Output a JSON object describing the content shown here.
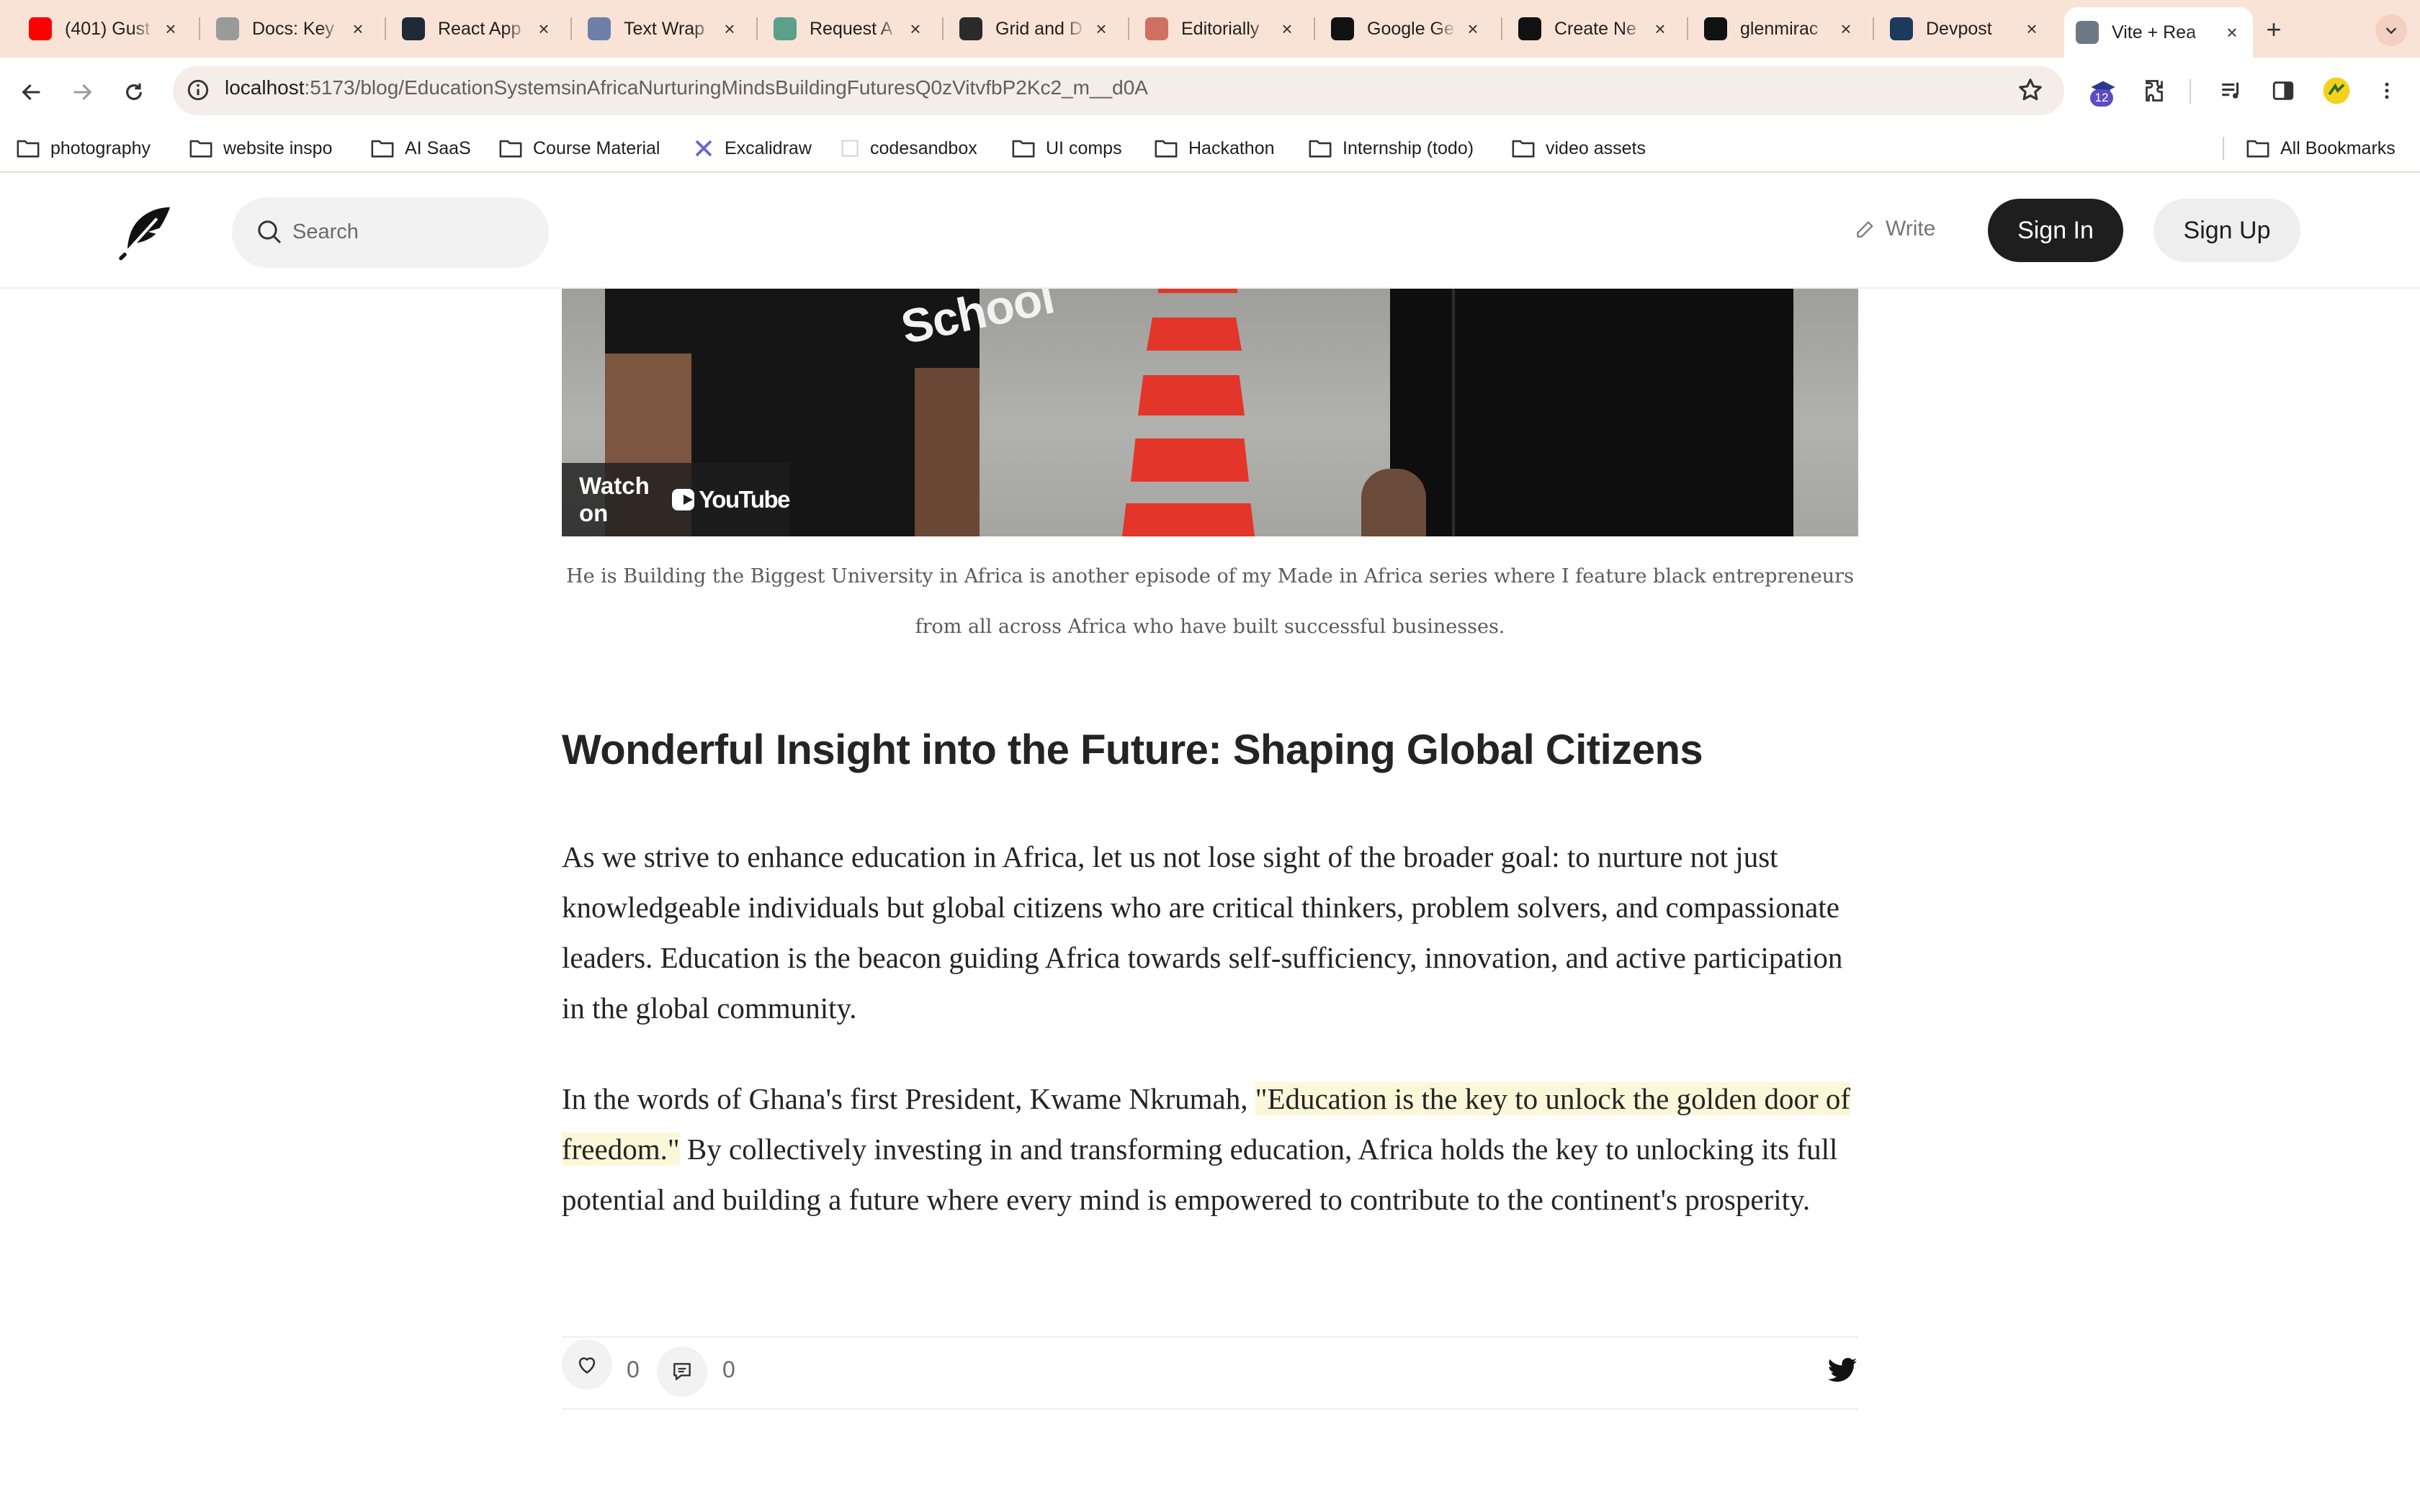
{
  "browser": {
    "tabs": [
      {
        "title": "(401) Gust",
        "favicon": "youtube-icon",
        "color": "#ff0000"
      },
      {
        "title": "Docs: Key",
        "favicon": "loading-icon",
        "color": "#9a9a9a"
      },
      {
        "title": "React App",
        "favicon": "react-icon",
        "color": "#1f2a36"
      },
      {
        "title": "Text Wrap",
        "favicon": "css-tool-icon",
        "color": "#6e7fa8"
      },
      {
        "title": "Request A",
        "favicon": "openai-icon",
        "color": "#5aa08a"
      },
      {
        "title": "Grid and D",
        "favicon": "grid-icon",
        "color": "#2a2a2a"
      },
      {
        "title": "Editorially",
        "favicon": "editorially-icon",
        "color": "#d07060"
      },
      {
        "title": "Google Ge",
        "favicon": "gemini-icon",
        "color": "#111111"
      },
      {
        "title": "Create Ne",
        "favicon": "triangle-icon",
        "color": "#111111"
      },
      {
        "title": "glenmirac",
        "favicon": "github-icon",
        "color": "#111111"
      },
      {
        "title": "Devpost",
        "favicon": "devpost-icon",
        "color": "#1b3a5c"
      },
      {
        "title": "Vite + Rea",
        "favicon": "globe-icon",
        "color": "#6d7a86"
      }
    ],
    "url_host": "localhost",
    "url_rest": ":5173/blog/EducationSystemsinAfricaNurturingMindsBuildingFuturesQ0zVitvfbP2Kc2_m__d0A",
    "extension_badge": "12",
    "bookmarks": [
      {
        "label": "photography",
        "icon": "folder-icon"
      },
      {
        "label": "website inspo",
        "icon": "folder-icon"
      },
      {
        "label": "AI SaaS",
        "icon": "folder-icon"
      },
      {
        "label": "Course Material",
        "icon": "folder-icon"
      },
      {
        "label": "Excalidraw",
        "icon": "excalidraw-icon"
      },
      {
        "label": "codesandbox",
        "icon": "codesandbox-icon"
      },
      {
        "label": "UI comps",
        "icon": "folder-icon"
      },
      {
        "label": "Hackathon",
        "icon": "folder-icon"
      },
      {
        "label": "Internship (todo)",
        "icon": "folder-icon"
      },
      {
        "label": "video assets",
        "icon": "folder-icon"
      }
    ],
    "all_bookmarks": "All Bookmarks"
  },
  "header": {
    "search_placeholder": "Search",
    "write_label": "Write",
    "signin_label": "Sign In",
    "signup_label": "Sign Up"
  },
  "video": {
    "watch_on": "Watch on",
    "youtube_word": "YouTube",
    "shirt_text": "School"
  },
  "caption": "He is Building the Biggest University in Africa is another episode of my Made in Africa series where I feature black entrepreneurs from all across Africa who have built successful businesses.",
  "article": {
    "heading": "Wonderful Insight into the Future: Shaping Global Citizens",
    "para1": "As we strive to enhance education in Africa, let us not lose sight of the broader goal: to nurture not just knowledgeable individuals but global citizens who are critical thinkers, problem solvers, and compassionate leaders. Education is the beacon guiding Africa towards self-sufficiency, innovation, and active participation in the global community.",
    "para2_before": "In the words of Ghana's first President, Kwame Nkrumah, ",
    "para2_quote": "\"Education is the key to unlock the golden door of freedom.\"",
    "para2_after": " By collectively investing in and transforming education, Africa holds the key to unlocking its full potential and building a future where every mind is empowered to contribute to the continent's prosperity."
  },
  "engagement": {
    "likes": "0",
    "comments": "0"
  },
  "colors": {
    "tabstrip": "#f9e3d6",
    "highlight": "#fdf7d9",
    "signin_bg": "#1e1e1e"
  }
}
